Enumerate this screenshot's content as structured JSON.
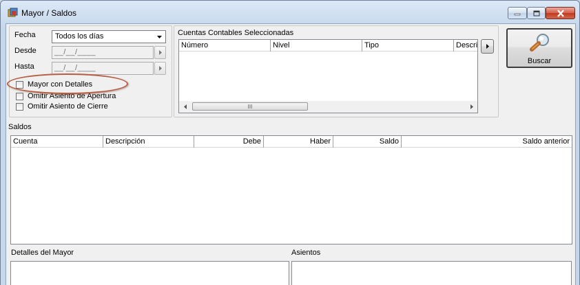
{
  "window": {
    "title": "Mayor / Saldos",
    "colors": {
      "close_button": "#c8432a",
      "title_gradient_top": "#dce8f6",
      "annotation_oval": "#b55d43"
    }
  },
  "filters": {
    "fecha_label": "Fecha",
    "fecha_value": "Todos los días",
    "desde_label": "Desde",
    "desde_value": "__/__/____",
    "hasta_label": "Hasta",
    "hasta_value": "__/__/____",
    "checkboxes": [
      {
        "label": "Mayor con Detalles",
        "checked": false
      },
      {
        "label": "Omitir Asiento de Apertura",
        "checked": false
      },
      {
        "label": "Omitir Asiento de Cierre",
        "checked": false
      }
    ]
  },
  "cuentas": {
    "title": "Cuentas Contables Seleccionadas",
    "columns": [
      "Número",
      "Nivel",
      "Tipo",
      "Descri"
    ],
    "scroll_grip": "III"
  },
  "search_button": {
    "label": "Buscar",
    "icon": "magnifier-icon"
  },
  "saldos": {
    "title": "Saldos",
    "columns": [
      "Cuenta",
      "Descripción",
      "Debe",
      "Haber",
      "Saldo",
      "Saldo anterior"
    ]
  },
  "detalles": {
    "title": "Detalles del Mayor"
  },
  "asientos": {
    "title": "Asientos"
  }
}
